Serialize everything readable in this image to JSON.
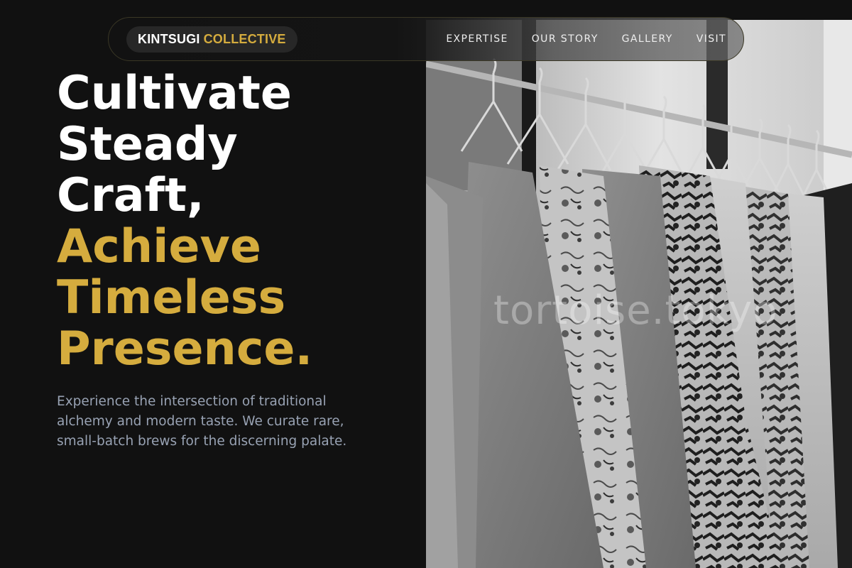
{
  "brand": {
    "word1": "KINTSUGI",
    "word2": "COLLECTIVE"
  },
  "nav": {
    "items": [
      {
        "label": "EXPERTISE"
      },
      {
        "label": "OUR STORY"
      },
      {
        "label": "GALLERY"
      },
      {
        "label": "VISIT"
      }
    ]
  },
  "hero": {
    "headline_white": [
      "Cultivate",
      "Steady",
      "Craft,"
    ],
    "headline_gold": [
      "Achieve",
      "Timeless",
      "Presence."
    ],
    "intro": "Experience the intersection of traditional alchemy and modern taste. We curate rare, small-batch brews for the discerning palate."
  },
  "photo": {
    "watermark": "tortoise.tokyo"
  },
  "colors": {
    "background": "#111111",
    "accent_gold": "#d5ac3e",
    "body_text": "#98a2b3",
    "nav_border": "#3a3725"
  },
  "icons": []
}
